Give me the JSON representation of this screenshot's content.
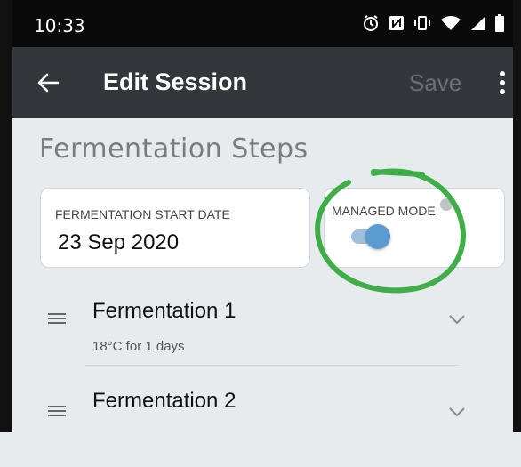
{
  "status": {
    "time": "10:33",
    "icons": [
      "alarm-icon",
      "nfc-icon",
      "vibrate-icon",
      "wifi-icon",
      "signal-icon",
      "battery-icon"
    ]
  },
  "app_bar": {
    "title": "Edit Session",
    "save_label": "Save",
    "back_icon": "arrow-left-icon",
    "more_icon": "more-vert-icon"
  },
  "section": {
    "title": "Fermentation Steps"
  },
  "start_date": {
    "label": "FERMENTATION START DATE",
    "value": "23 Sep 2020"
  },
  "managed_mode": {
    "label": "MANAGED MODE",
    "enabled": true
  },
  "steps": [
    {
      "name": "Fermentation 1",
      "description": "18°C for 1 days"
    },
    {
      "name": "Fermentation 2",
      "description": ""
    }
  ],
  "colors": {
    "app_bar": "#33373b",
    "status_bar": "#0a0a0a",
    "toggle": "#5b9bd0",
    "annotation": "#3fae49"
  }
}
